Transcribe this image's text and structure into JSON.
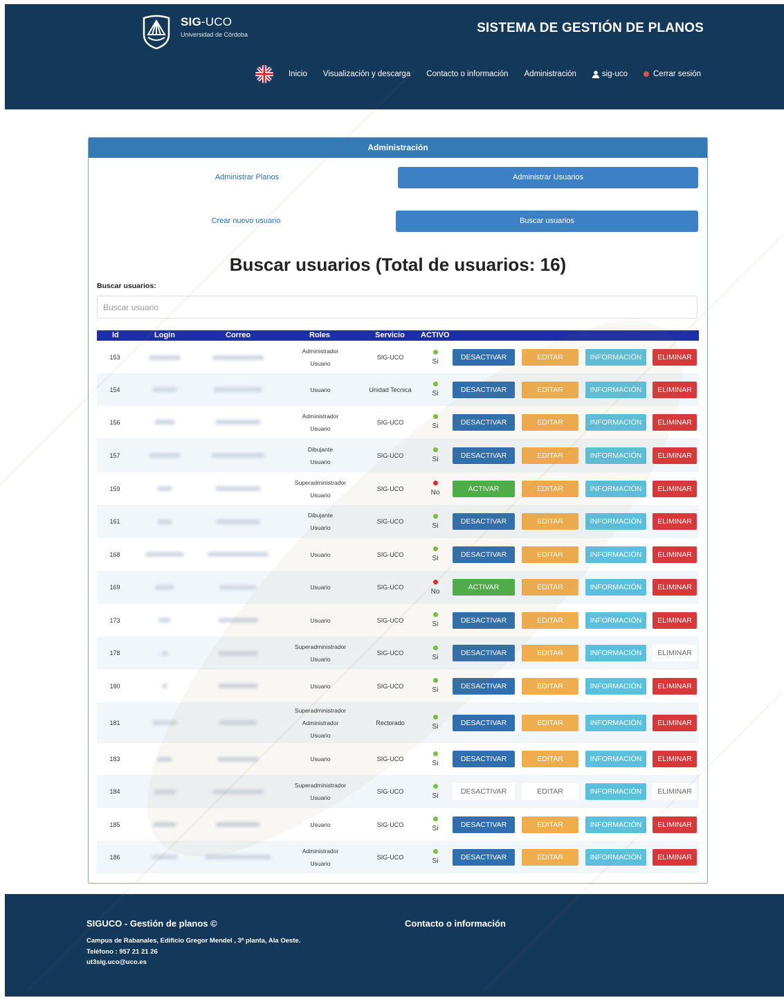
{
  "header": {
    "brand_strong": "SIG",
    "brand_rest": "-UCO",
    "brand_sub": "Universidad de Córdoba",
    "system_title": "SISTEMA DE GESTIÓN DE PLANOS",
    "nav": {
      "inicio": "Inicio",
      "visualizacion": "Visualización y descarga",
      "contacto": "Contacto o información",
      "administracion": "Administración",
      "user": "sig-uco",
      "logout": "Cerrar sesión"
    }
  },
  "panel": {
    "title": "Administración",
    "admin_planos": "Administrar Planos",
    "admin_usuarios": "Administrar Usuarios",
    "crear_usuario": "Crear nuevo usuario",
    "buscar_usuarios": "Buscar usuarios",
    "page_title": "Buscar usuarios (Total de usuarios: 16)",
    "search_label": "Buscar usuarios:",
    "search_placeholder": "Buscar usuario"
  },
  "table": {
    "headers": {
      "id": "Id",
      "login": "Login",
      "correo": "Correo",
      "roles": "Roles",
      "servicio": "Servicio",
      "activo": "ACTIVO"
    },
    "buttons": {
      "desactivar": "DESACTIVAR",
      "activar": "ACTIVAR",
      "editar": "EDITAR",
      "informacion": "INFORMACIÓN",
      "eliminar": "ELIMINAR"
    },
    "rows": [
      {
        "id": "153",
        "roles": [
          "Administrador",
          "Usuario"
        ],
        "servicio": "SIG-UCO",
        "activo": "Si"
      },
      {
        "id": "154",
        "roles": [
          "Usuario"
        ],
        "servicio": "Unidad Tecnica",
        "activo": "Si"
      },
      {
        "id": "156",
        "roles": [
          "Administrador",
          "Usuario"
        ],
        "servicio": "SIG-UCO",
        "activo": "Si"
      },
      {
        "id": "157",
        "roles": [
          "Dibujante",
          "Usuario"
        ],
        "servicio": "SIG-UCO",
        "activo": "Si"
      },
      {
        "id": "159",
        "roles": [
          "Superadministrador",
          "Usuario"
        ],
        "servicio": "SIG-UCO",
        "activo": "No"
      },
      {
        "id": "161",
        "roles": [
          "Dibujante",
          "Usuario"
        ],
        "servicio": "SIG-UCO",
        "activo": "Si"
      },
      {
        "id": "168",
        "roles": [
          "Usuario"
        ],
        "servicio": "SIG-UCO",
        "activo": "Si"
      },
      {
        "id": "169",
        "roles": [
          "Usuario"
        ],
        "servicio": "SIG-UCO",
        "activo": "No"
      },
      {
        "id": "173",
        "roles": [
          "Usuario"
        ],
        "servicio": "SIG-UCO",
        "activo": "Si"
      },
      {
        "id": "178",
        "roles": [
          "Superadministrador",
          "Usuario"
        ],
        "servicio": "SIG-UCO",
        "activo": "Si",
        "delete_disabled": true
      },
      {
        "id": "180",
        "roles": [
          "Usuario"
        ],
        "servicio": "SIG-UCO",
        "activo": "Si"
      },
      {
        "id": "181",
        "roles": [
          "Superadministrador",
          "Administrador",
          "Usuario"
        ],
        "servicio": "Rectorado",
        "activo": "Si"
      },
      {
        "id": "183",
        "roles": [
          "Usuario"
        ],
        "servicio": "SIG-UCO",
        "activo": "Si"
      },
      {
        "id": "184",
        "roles": [
          "Superadministrador",
          "Usuario"
        ],
        "servicio": "SIG-UCO",
        "activo": "Si",
        "all_disabled": true
      },
      {
        "id": "185",
        "roles": [
          "Usuario"
        ],
        "servicio": "SIG-UCO",
        "activo": "Si"
      },
      {
        "id": "186",
        "roles": [
          "Administrador",
          "Usuario"
        ],
        "servicio": "SIG-UCO",
        "activo": "Si"
      }
    ]
  },
  "footer": {
    "title": "SIGUCO - Gestión de planos ©",
    "address": "Campus de Rabanales, Edificio Gregor Mendel , 3ª planta, Ala Oeste.",
    "phone": "Teléfono : 957 21 21 26",
    "email": "ut3sig.uco@uco.es",
    "contact": "Contacto o información"
  },
  "colors": {
    "header_bg": "#14385a",
    "primary": "#337ab7",
    "success": "#4cae4c",
    "warning": "#f0ad4e",
    "info": "#5bc0de",
    "danger": "#d9383a"
  },
  "icons": {
    "logo": "uco-shell-logo-icon",
    "flag": "uk-flag-icon",
    "user": "user-icon",
    "logout": "logout-icon"
  }
}
